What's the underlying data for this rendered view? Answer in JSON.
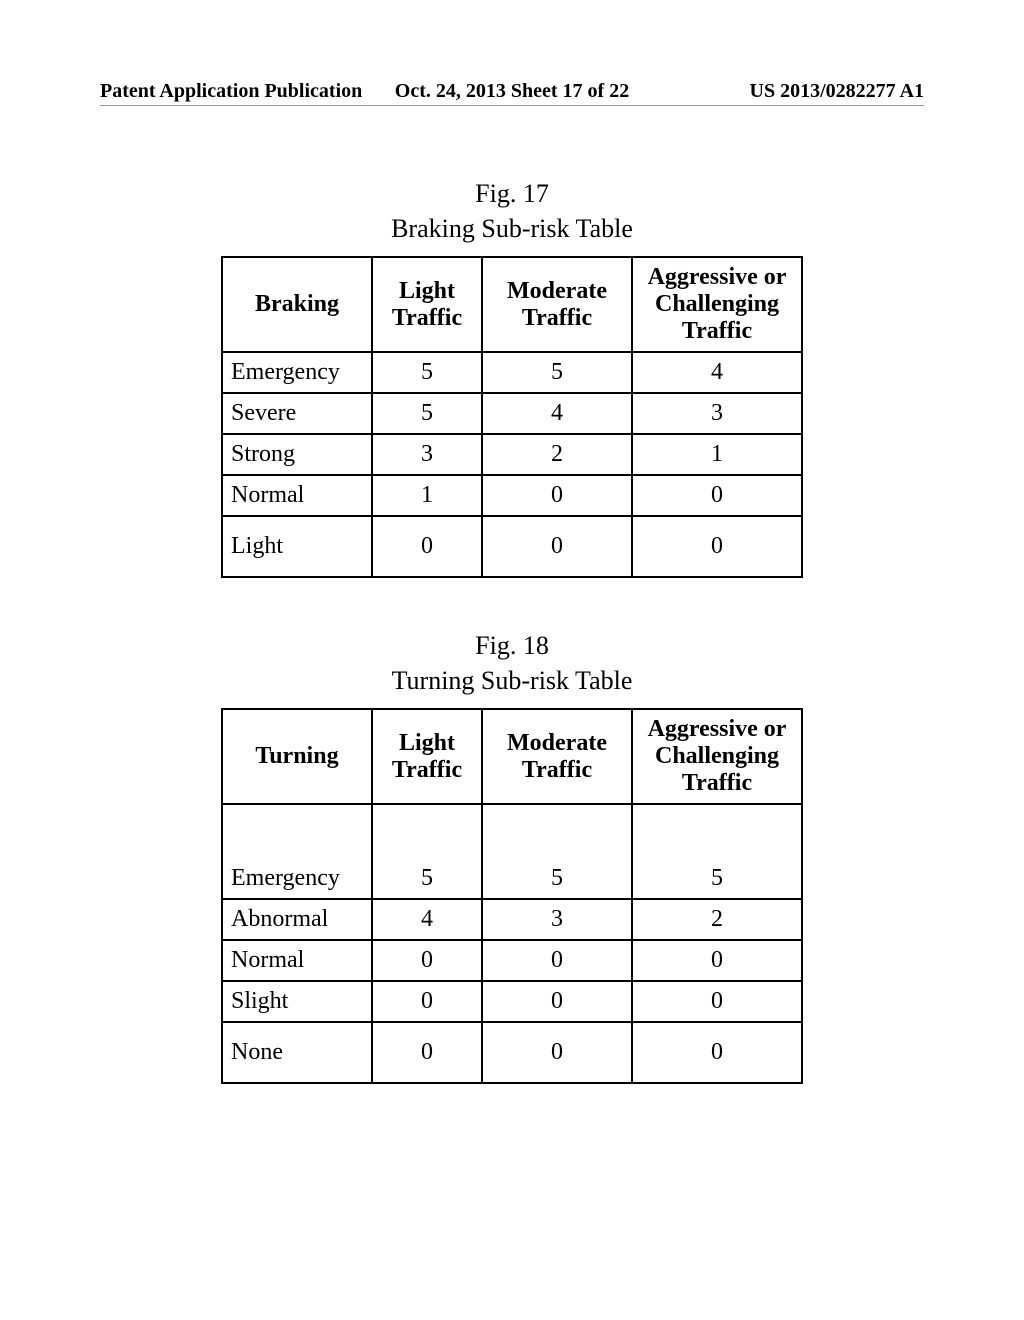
{
  "header": {
    "left": "Patent Application Publication",
    "center": "Oct. 24, 2013  Sheet 17 of 22",
    "right": "US 2013/0282277 A1"
  },
  "fig17": {
    "fig_label": "Fig. 17",
    "title": "Braking Sub-risk Table",
    "columns": {
      "rowhead": "Braking",
      "c1": "Light Traffic",
      "c2": "Moderate Traffic",
      "c3": "Aggressive or Challenging Traffic"
    },
    "rows": [
      {
        "label": "Emergency",
        "v1": "5",
        "v2": "5",
        "v3": "4"
      },
      {
        "label": "Severe",
        "v1": "5",
        "v2": "4",
        "v3": "3"
      },
      {
        "label": "Strong",
        "v1": "3",
        "v2": "2",
        "v3": "1"
      },
      {
        "label": "Normal",
        "v1": "1",
        "v2": "0",
        "v3": "0"
      },
      {
        "label": "Light",
        "v1": "0",
        "v2": "0",
        "v3": "0"
      }
    ]
  },
  "fig18": {
    "fig_label": "Fig. 18",
    "title": "Turning Sub-risk Table",
    "columns": {
      "rowhead": "Turning",
      "c1": "Light Traffic",
      "c2": "Moderate Traffic",
      "c3": "Aggressive or Challenging Traffic"
    },
    "rows": [
      {
        "label": "Emergency",
        "v1": "5",
        "v2": "5",
        "v3": "5"
      },
      {
        "label": "Abnormal",
        "v1": "4",
        "v2": "3",
        "v3": "2"
      },
      {
        "label": "Normal",
        "v1": "0",
        "v2": "0",
        "v3": "0"
      },
      {
        "label": "Slight",
        "v1": "0",
        "v2": "0",
        "v3": "0"
      },
      {
        "label": "None",
        "v1": "0",
        "v2": "0",
        "v3": "0"
      }
    ]
  },
  "chart_data": [
    {
      "type": "table",
      "title": "Braking Sub-risk Table",
      "columns": [
        "Braking",
        "Light Traffic",
        "Moderate Traffic",
        "Aggressive or Challenging Traffic"
      ],
      "rows": [
        [
          "Emergency",
          5,
          5,
          4
        ],
        [
          "Severe",
          5,
          4,
          3
        ],
        [
          "Strong",
          3,
          2,
          1
        ],
        [
          "Normal",
          1,
          0,
          0
        ],
        [
          "Light",
          0,
          0,
          0
        ]
      ]
    },
    {
      "type": "table",
      "title": "Turning Sub-risk Table",
      "columns": [
        "Turning",
        "Light Traffic",
        "Moderate Traffic",
        "Aggressive or Challenging Traffic"
      ],
      "rows": [
        [
          "Emergency",
          5,
          5,
          5
        ],
        [
          "Abnormal",
          4,
          3,
          2
        ],
        [
          "Normal",
          0,
          0,
          0
        ],
        [
          "Slight",
          0,
          0,
          0
        ],
        [
          "None",
          0,
          0,
          0
        ]
      ]
    }
  ]
}
